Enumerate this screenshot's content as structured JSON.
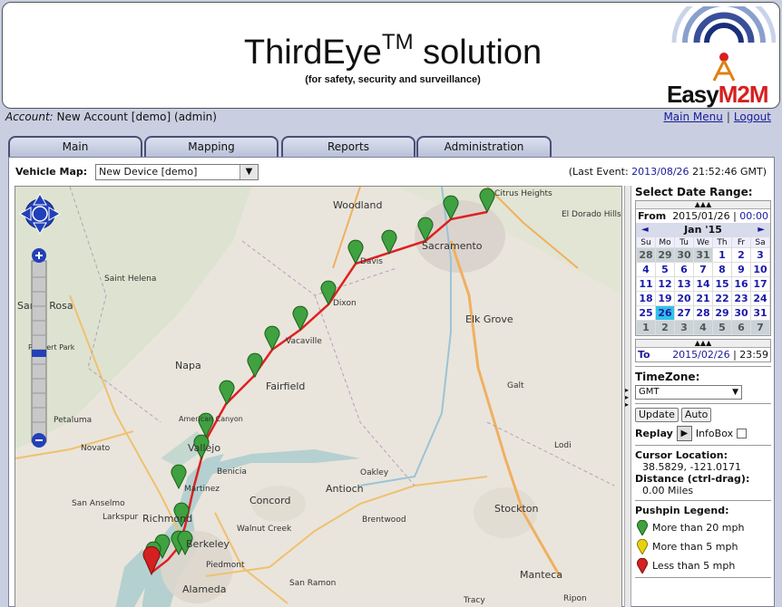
{
  "header": {
    "title": "ThirdEye",
    "title_sup": "TM",
    "title_suffix": "solution",
    "subtitle": "(for safety, security and surveillance)",
    "logo_easy": "Easy",
    "logo_m2m": "M2M"
  },
  "account": {
    "label": "Account:",
    "value": "New Account [demo] (admin)"
  },
  "links": {
    "main_menu": "Main Menu",
    "sep": "|",
    "logout": "Logout"
  },
  "tabs": [
    "Main",
    "Mapping",
    "Reports",
    "Administration"
  ],
  "vehicle": {
    "label": "Vehicle Map:",
    "selected": "New Device [demo]",
    "last_event_prefix": "(Last Event:",
    "last_event_date": "2013/08/26",
    "last_event_time": "21:52:46 GMT)"
  },
  "map": {
    "labels": [
      "Woodland",
      "Citrus Heights",
      "El Dorado Hills",
      "Sacramento",
      "Davis",
      "Dixon",
      "Elk Grove",
      "Vacaville",
      "Fairfield",
      "Napa",
      "Saint Helena",
      "Santa Rosa",
      "Rohnert Park",
      "Petaluma",
      "American Canyon",
      "Vallejo",
      "Benicia",
      "Novato",
      "Martinez",
      "Concord",
      "Antioch",
      "Galt",
      "Lodi",
      "Stockton",
      "San Anselmo",
      "Larkspur",
      "Richmond",
      "Walnut Creek",
      "Brentwood",
      "Berkeley",
      "Piedmont",
      "Alameda",
      "San Ramon",
      "Manteca",
      "Tracy",
      "Ripon",
      "Oakley"
    ]
  },
  "calendar": {
    "header": "Select Date Range:",
    "from_label": "From",
    "from_date": "2015/01/26",
    "from_time": "00:00",
    "month": "Jan '15",
    "prev": "◄",
    "next": "►",
    "days": [
      "Su",
      "Mo",
      "Tu",
      "We",
      "Th",
      "Fr",
      "Sa"
    ],
    "weeks": [
      [
        "28",
        "29",
        "30",
        "31",
        "1",
        "2",
        "3"
      ],
      [
        "4",
        "5",
        "6",
        "7",
        "8",
        "9",
        "10"
      ],
      [
        "11",
        "12",
        "13",
        "14",
        "15",
        "16",
        "17"
      ],
      [
        "18",
        "19",
        "20",
        "21",
        "22",
        "23",
        "24"
      ],
      [
        "25",
        "26",
        "27",
        "28",
        "29",
        "30",
        "31"
      ],
      [
        "1",
        "2",
        "3",
        "4",
        "5",
        "6",
        "7"
      ]
    ],
    "to_label": "To",
    "to_date": "2015/02/26",
    "to_time": "23:59"
  },
  "timezone": {
    "label": "TimeZone:",
    "value": "GMT"
  },
  "buttons": {
    "update": "Update",
    "auto": "Auto",
    "replay": "Replay",
    "infobox": "InfoBox"
  },
  "cursor": {
    "label": "Cursor Location:",
    "value": "38.5829, -121.0171"
  },
  "distance": {
    "label": "Distance (ctrl-drag):",
    "value": "0.00 Miles"
  },
  "legend": {
    "title": "Pushpin Legend:",
    "items": [
      {
        "label": "More than 20 mph",
        "color": "#3fa13f"
      },
      {
        "label": "More than 5 mph",
        "color": "#e8d210"
      },
      {
        "label": "Less than 5 mph",
        "color": "#d42020"
      }
    ]
  },
  "colors": {
    "route": "#e02020",
    "accent": "#1a1a9a",
    "selected_day": "#31c2e8"
  }
}
